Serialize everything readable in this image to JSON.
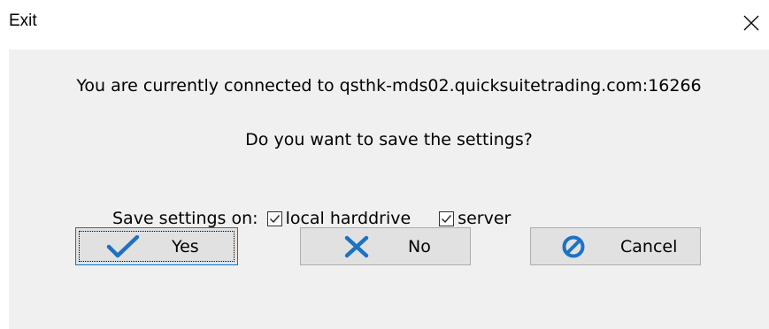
{
  "window": {
    "title": "Exit",
    "close_icon": "close-icon"
  },
  "message": {
    "line1": "You are currently connected to qsthk-mds02.quicksuitetrading.com:16266",
    "line2": "Do you want to save the settings?"
  },
  "save_settings": {
    "label": "Save settings on:",
    "options": [
      {
        "label": "local harddrive",
        "checked": true
      },
      {
        "label": "server",
        "checked": true
      }
    ]
  },
  "buttons": {
    "yes": {
      "label": "Yes",
      "icon": "checkmark-icon",
      "color": "#1c72c4"
    },
    "no": {
      "label": "No",
      "icon": "x-icon",
      "color": "#1c72c4"
    },
    "cancel": {
      "label": "Cancel",
      "icon": "prohibited-icon",
      "color": "#1c72c4"
    }
  }
}
